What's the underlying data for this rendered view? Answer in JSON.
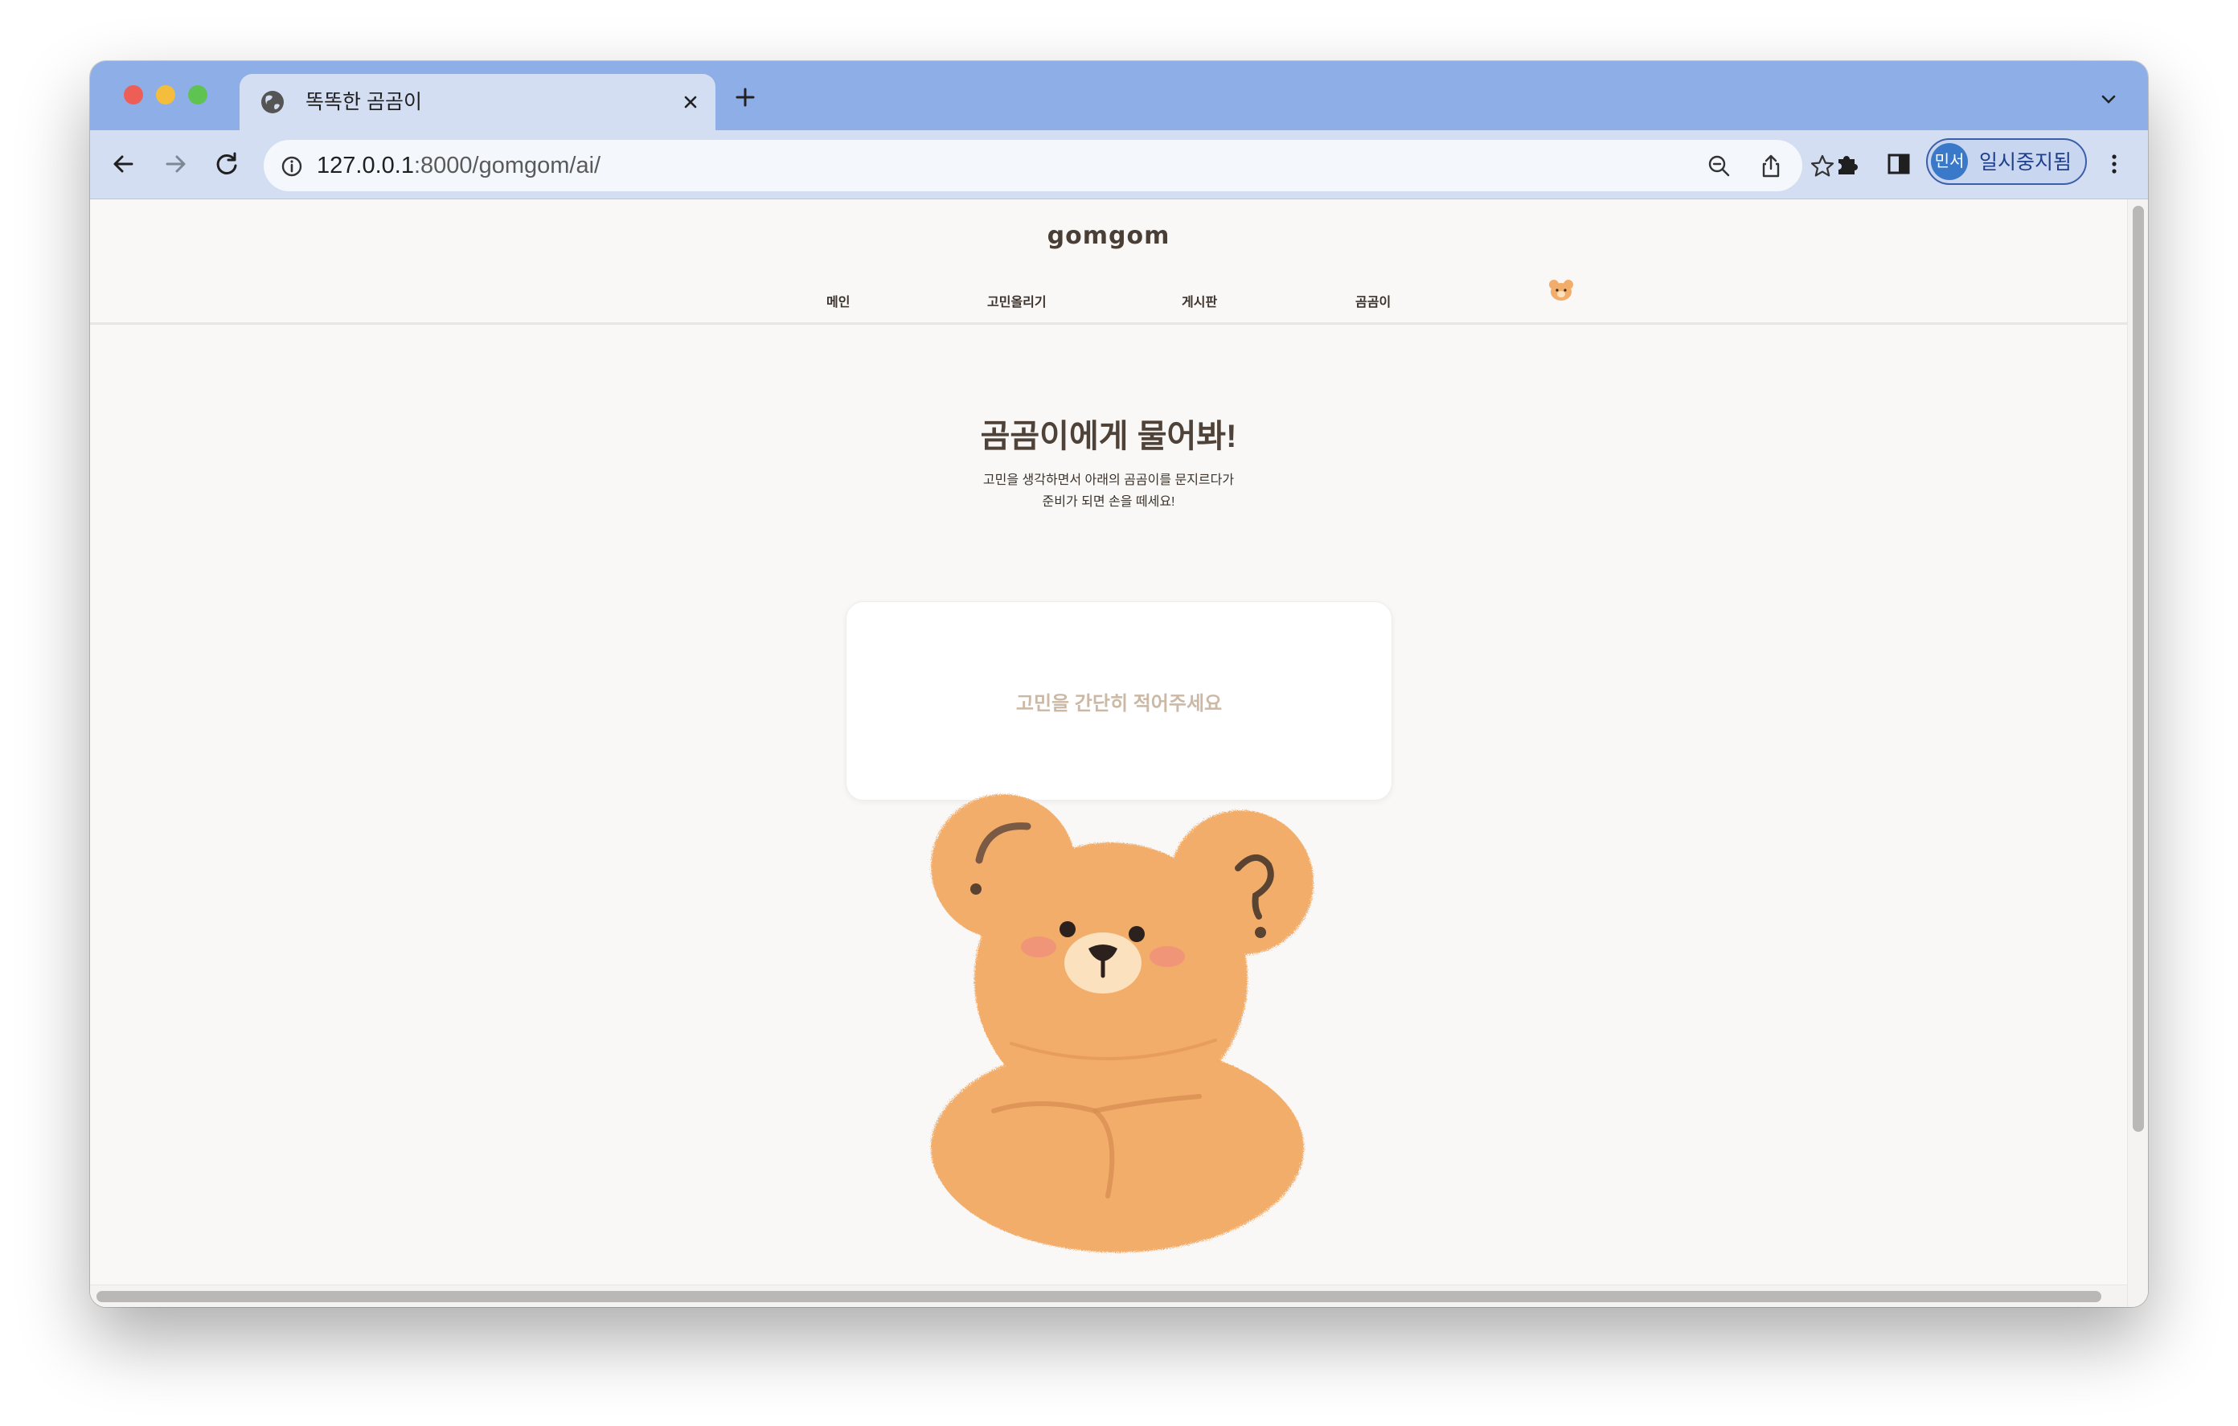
{
  "browser": {
    "tab": {
      "title": "똑똑한 곰곰이",
      "favicon": "globe-icon"
    },
    "address": {
      "host": "127.0.0.1",
      "rest": ":8000/gomgom/ai/"
    },
    "profile": {
      "avatar_text": "민서",
      "label": "일시중지됨"
    },
    "accent": "#8eaee8"
  },
  "site": {
    "logo": "gomgom",
    "nav": [
      "메인",
      "고민올리기",
      "게시판",
      "곰곰이"
    ]
  },
  "main": {
    "title": "곰곰이에게 물어봐!",
    "desc_line1": "고민을 생각하면서 아래의 곰곰이를 문지르다가",
    "desc_line2": "준비가 되면 손을 떼세요!",
    "input_placeholder": "고민을 간단히 적어주세요"
  },
  "colors": {
    "bear": "#f2ad6b",
    "page_bg": "#f9f8f6",
    "text": "#4f4238"
  }
}
